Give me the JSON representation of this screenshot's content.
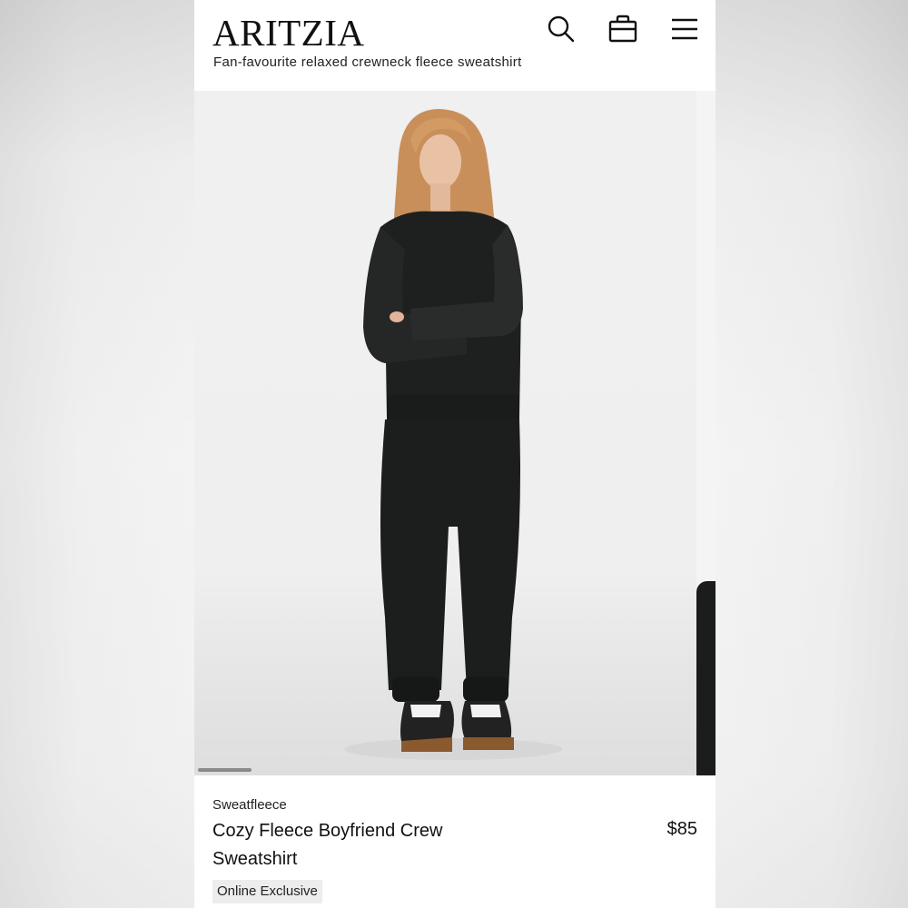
{
  "header": {
    "logo": "ARITZIA",
    "subtitle": "Fan-favourite relaxed crewneck fleece sweatshirt",
    "icons": [
      "search-icon",
      "shopping-bag-icon",
      "menu-icon"
    ]
  },
  "gallery": {
    "image_alt": "Model wearing black crewneck sweatshirt and black sweatpants"
  },
  "product": {
    "brand": "Sweatfleece",
    "name": "Cozy Fleece Boyfriend Crew Sweatshirt",
    "price": "$85",
    "badge": "Online Exclusive"
  }
}
